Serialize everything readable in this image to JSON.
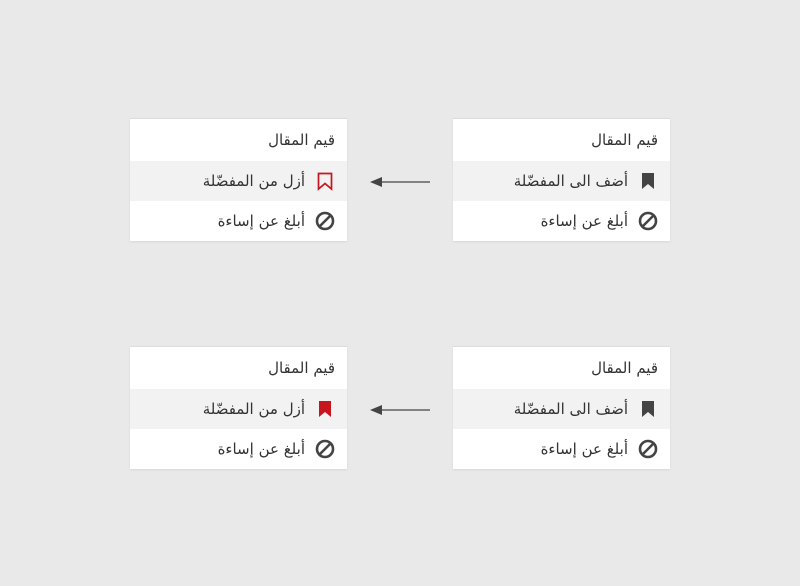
{
  "colors": {
    "accent_red": "#c8141c",
    "icon_dark": "#444444"
  },
  "before_top": {
    "title": "قيم المقال",
    "bookmark_label": "أضف الى المفضّلة",
    "bookmark_icon": "bookmark-filled-icon",
    "report_label": "أبلغ عن إساءة",
    "report_icon": "block-icon"
  },
  "after_top": {
    "title": "قيم المقال",
    "bookmark_label": "أزل من المفضّلة",
    "bookmark_icon": "bookmark-outline-red-icon",
    "report_label": "أبلغ عن إساءة",
    "report_icon": "block-icon"
  },
  "before_bottom": {
    "title": "قيم المقال",
    "bookmark_label": "أضف الى المفضّلة",
    "bookmark_icon": "bookmark-filled-icon",
    "report_label": "أبلغ عن إساءة",
    "report_icon": "block-icon"
  },
  "after_bottom": {
    "title": "قيم المقال",
    "bookmark_label": "أزل من المفضّلة",
    "bookmark_icon": "bookmark-filled-red-icon",
    "report_label": "أبلغ عن إساءة",
    "report_icon": "block-icon"
  }
}
